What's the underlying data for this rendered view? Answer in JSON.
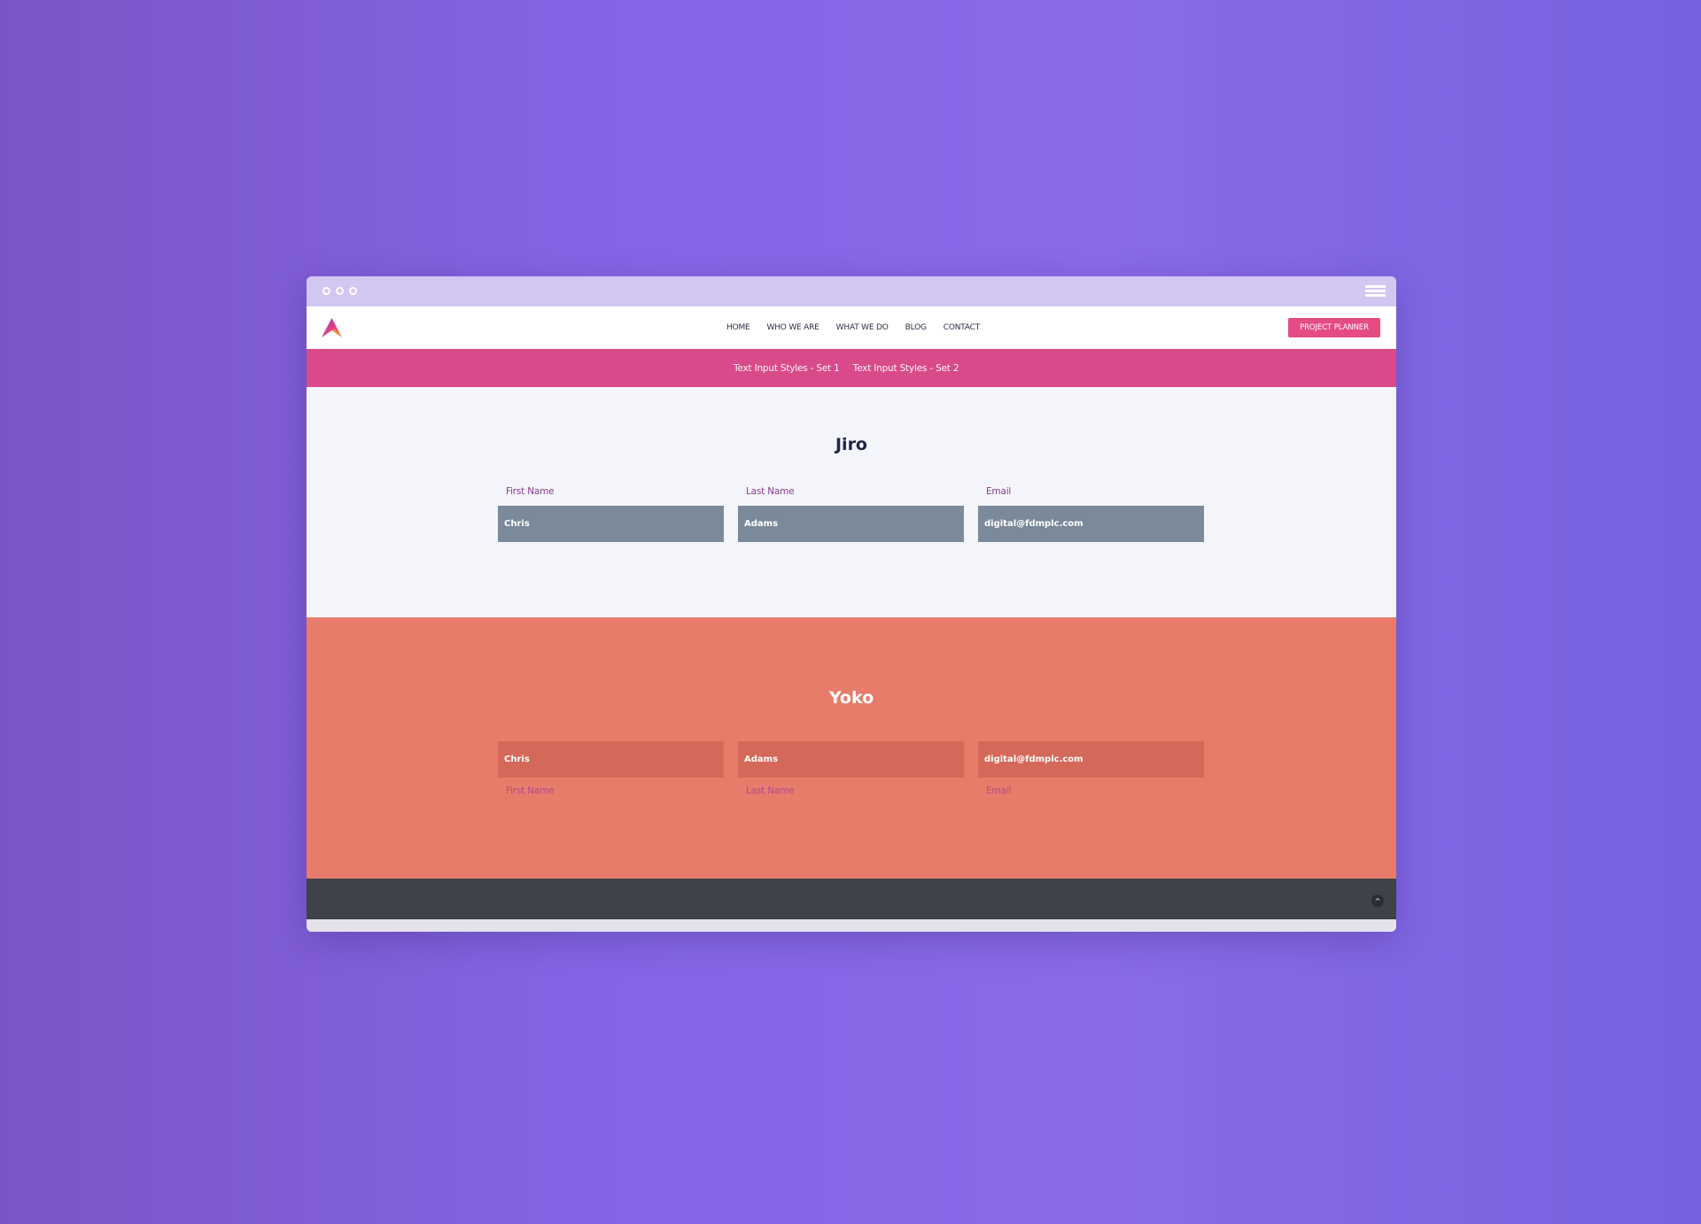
{
  "colors": {
    "accent": "#e54c86",
    "subnav": "#d84a8a",
    "jiro_input": "#7b8a9b",
    "yoko_bg": "#e77c6b",
    "yoko_input": "#d4695a",
    "footer": "#3e4249"
  },
  "browser": {
    "window_controls": [
      "circle-icon",
      "circle-icon",
      "circle-icon"
    ],
    "menu_icon": "hamburger-icon"
  },
  "header": {
    "logo_icon": "brand-logo-icon",
    "nav": [
      "HOME",
      "WHO WE ARE",
      "WHAT WE DO",
      "BLOG",
      "CONTACT"
    ],
    "cta_label": "PROJECT PLANNER"
  },
  "subnav": {
    "links": [
      "Text Input Styles - Set 1",
      "Text Input Styles - Set 2"
    ]
  },
  "jiro": {
    "title": "Jiro",
    "fields": [
      {
        "label": "First Name",
        "value": "Chris"
      },
      {
        "label": "Last Name",
        "value": "Adams"
      },
      {
        "label": "Email",
        "value": "digital@fdmplc.com"
      }
    ]
  },
  "yoko": {
    "title": "Yoko",
    "fields": [
      {
        "label": "First Name",
        "value": "Chris"
      },
      {
        "label": "Last Name",
        "value": "Adams"
      },
      {
        "label": "Email",
        "value": "digital@fdmplc.com"
      }
    ]
  },
  "footer": {
    "back_to_top_icon": "chevron-up-icon",
    "back_to_top_glyph": "^"
  }
}
